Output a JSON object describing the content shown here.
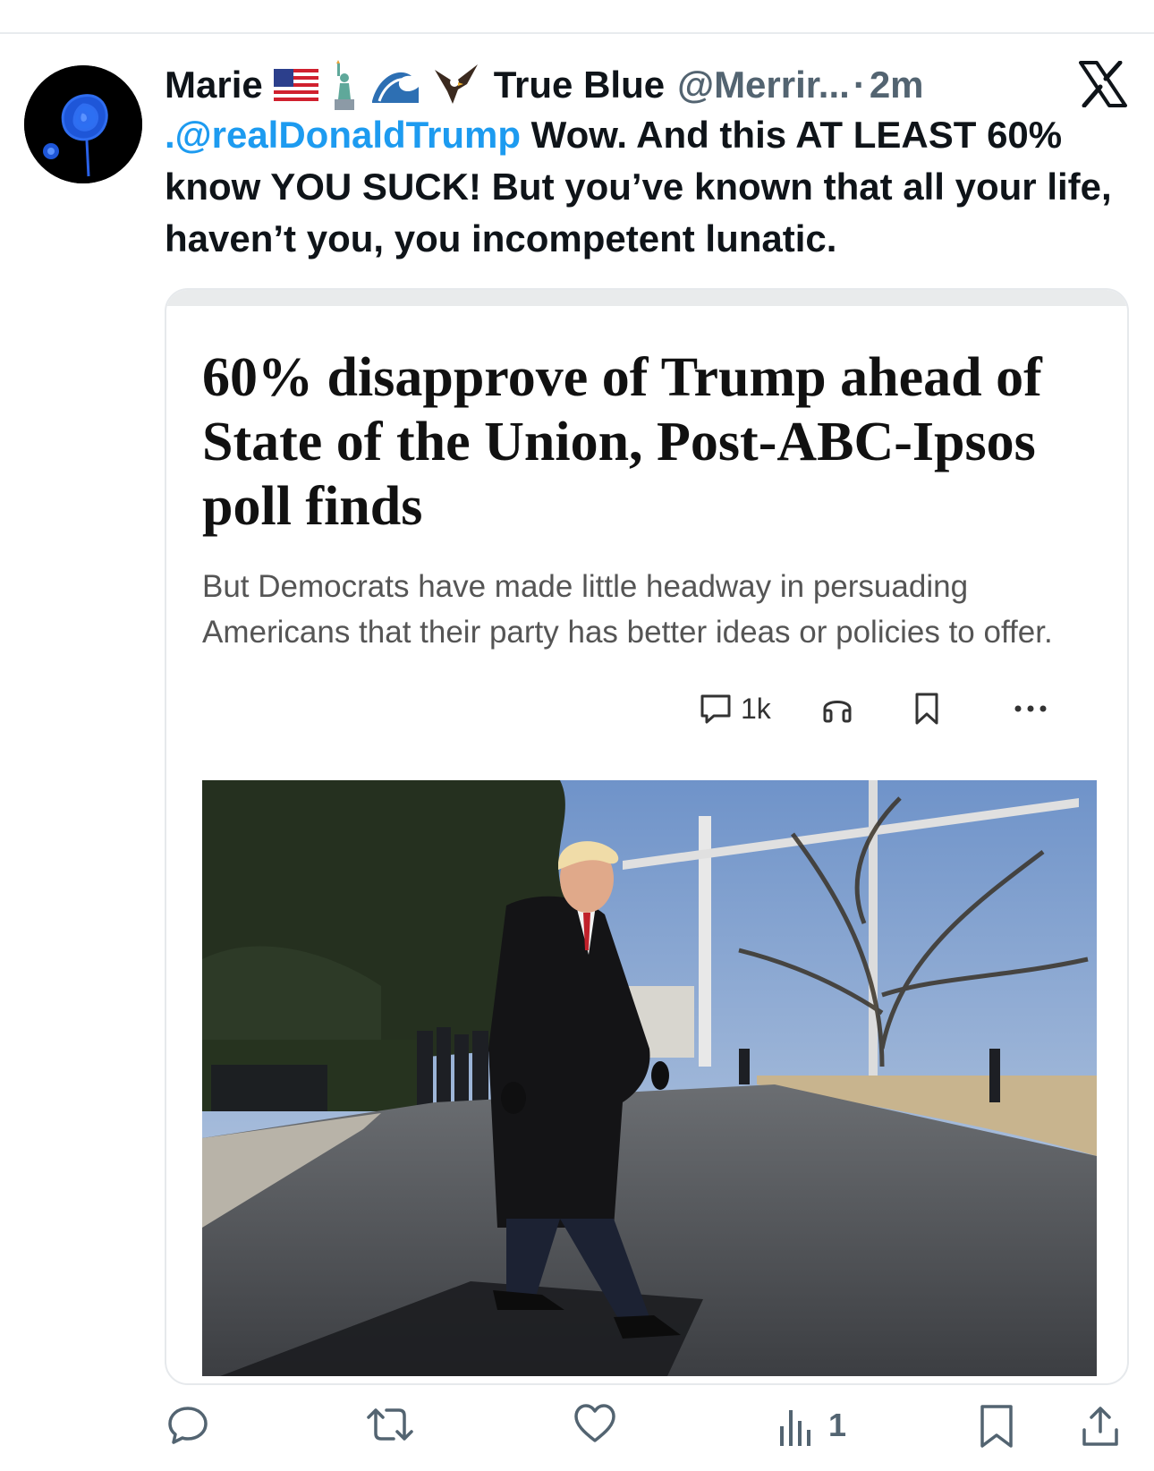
{
  "tweet": {
    "display_name": "Marie",
    "display_name_suffix": "True Blue",
    "emojis": [
      "us-flag",
      "statue-of-liberty",
      "wave",
      "eagle"
    ],
    "handle": "@Merrir...",
    "separator": "·",
    "time": "2m",
    "mention": ".@realDonaldTrump",
    "text": " Wow. And this AT LEAST 60% know YOU SUCK! But you’ve known that all your life, haven’t you, you incompetent lunatic."
  },
  "card": {
    "headline": "60% disapprove of Trump ahead of State of the Union, Post-ABC-Ipsos poll finds",
    "subhead": "But Democrats have made little headway in persuading Americans that their party has better ideas or policies to offer.",
    "comment_count": "1k",
    "icons": [
      "comment-icon",
      "headphones-icon",
      "bookmark-icon",
      "more-icon"
    ],
    "photo_description_icon": "photo"
  },
  "actions": {
    "icons": [
      "reply-icon",
      "retweet-icon",
      "like-icon",
      "views-icon",
      "bookmark-icon",
      "share-icon"
    ],
    "views": "1"
  },
  "colors": {
    "accent": "#1d9bf0",
    "text": "#0f1419",
    "muted": "#536471"
  }
}
